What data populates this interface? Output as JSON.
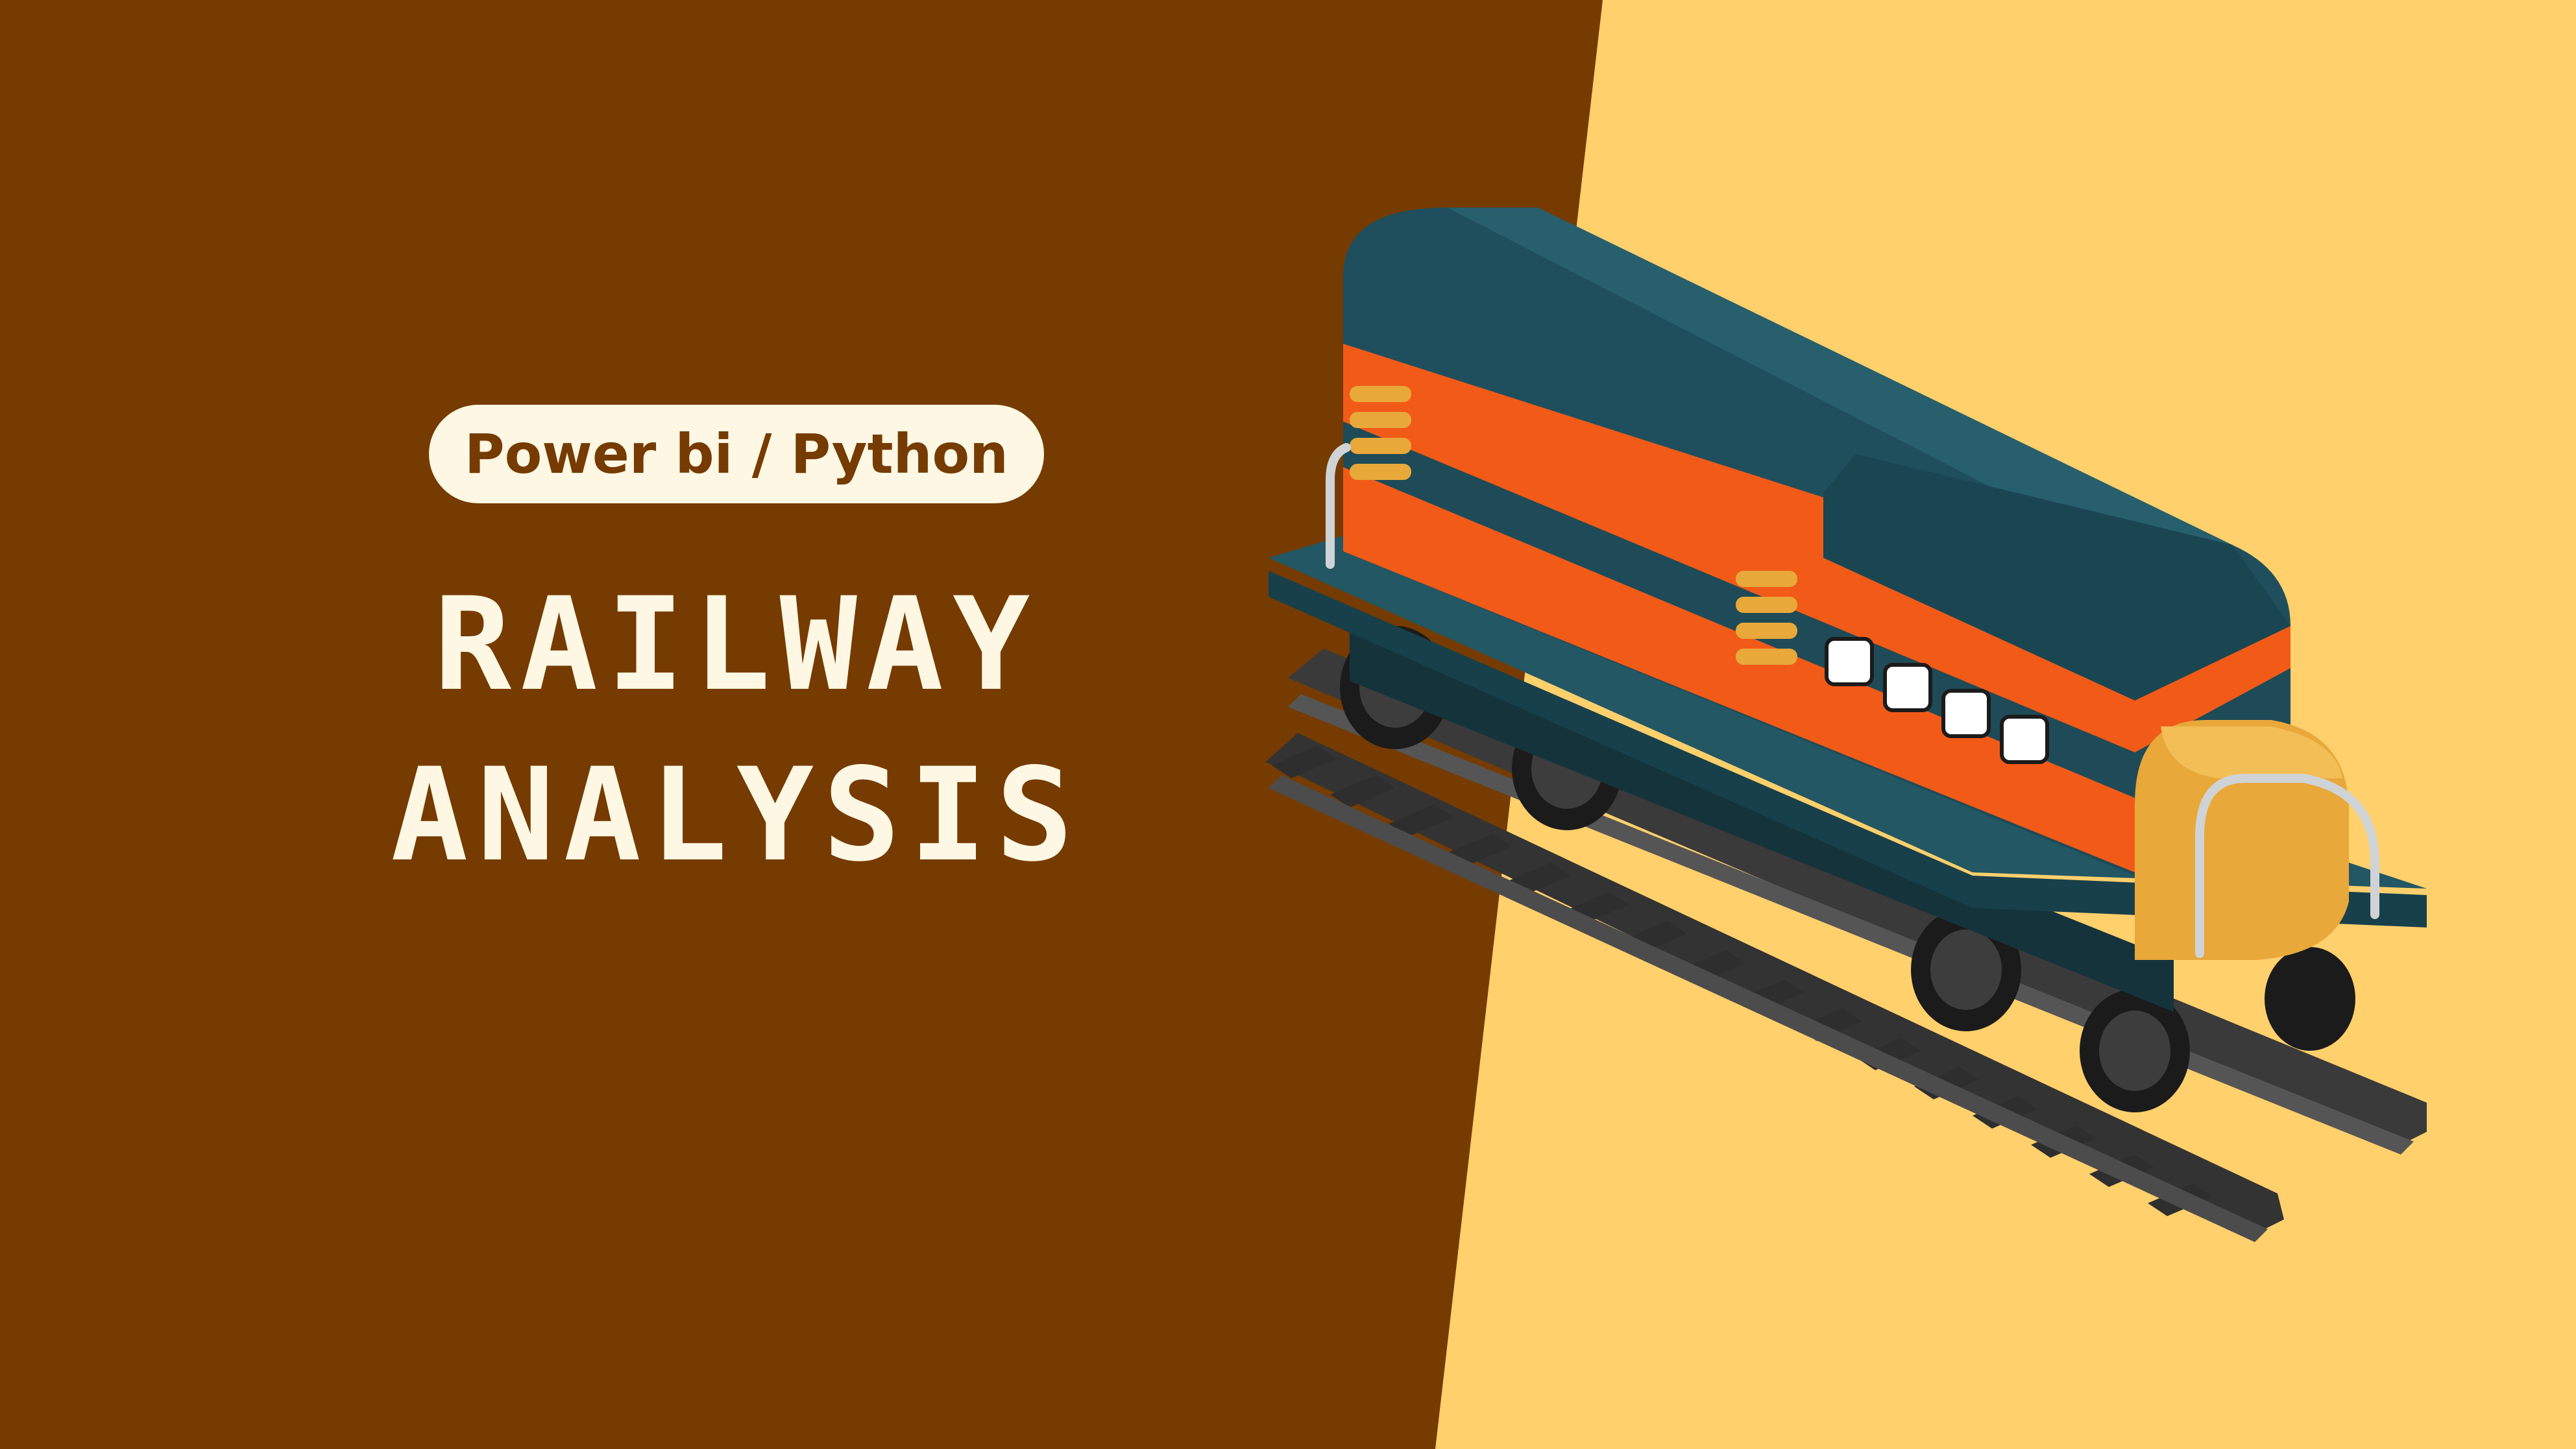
{
  "tag": {
    "label": "Power bi / Python"
  },
  "title": {
    "line1": "RAILWAY",
    "line2": "ANALYSIS"
  },
  "illustration": {
    "icon": "locomotive-on-rails-icon"
  },
  "colors": {
    "background_left": "#763B00",
    "background_right": "#FFD06C",
    "text_light": "#FDF7E4",
    "train_body": "#1E4B57",
    "train_stripe": "#F25A18",
    "train_accent": "#E8A83A"
  }
}
